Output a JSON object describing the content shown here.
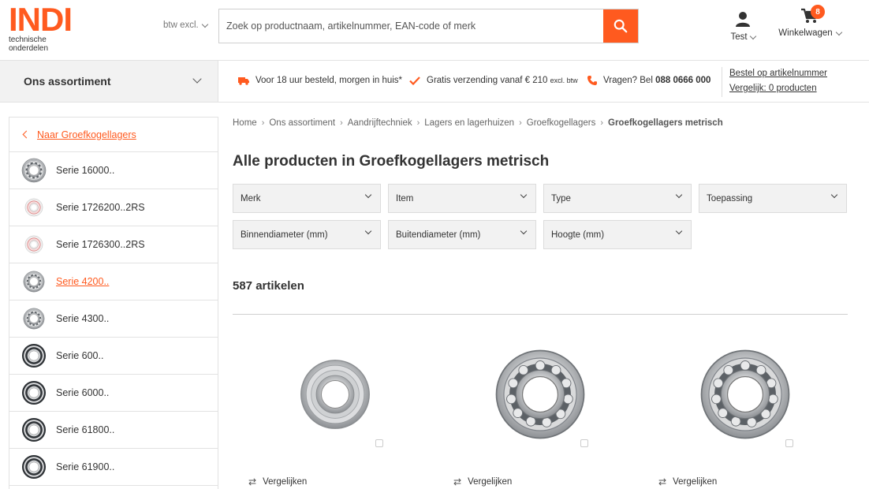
{
  "header": {
    "logo_text": "INDI",
    "logo_sub": "technische onderdelen",
    "vat_toggle": "btw excl.",
    "search_placeholder": "Zoek op productnaam, artikelnummer, EAN-code of merk",
    "account_label": "Test",
    "cart_label": "Winkelwagen",
    "cart_count": "8"
  },
  "usp": {
    "assortment_label": "Ons assortiment",
    "delivery": "Voor 18 uur besteld, morgen in huis*",
    "shipping_main": "Gratis verzending vanaf € 210",
    "shipping_small": "excl. btw",
    "phone_prefix": "Vragen? Bel",
    "phone_number": "088 0666 000",
    "order_by_number": "Bestel op artikelnummer",
    "compare_link": "Vergelijk: 0 producten"
  },
  "sidebar": {
    "back_label": "Naar Groefkogellagers",
    "items": [
      {
        "label": "Serie 16000..",
        "icon": "bearing-icon"
      },
      {
        "label": "Serie 1726200..2RS",
        "icon": "bearing-icon"
      },
      {
        "label": "Serie 1726300..2RS",
        "icon": "bearing-icon"
      },
      {
        "label": "Serie 4200..",
        "icon": "bearing-icon"
      },
      {
        "label": "Serie 4300..",
        "icon": "bearing-icon"
      },
      {
        "label": "Serie 600..",
        "icon": "bearing-icon"
      },
      {
        "label": "Serie 6000..",
        "icon": "bearing-icon"
      },
      {
        "label": "Serie 61800..",
        "icon": "bearing-icon"
      },
      {
        "label": "Serie 61900..",
        "icon": "bearing-icon"
      }
    ]
  },
  "breadcrumb": [
    "Home",
    "Ons assortiment",
    "Aandrijftechniek",
    "Lagers en lagerhuizen",
    "Groefkogellagers",
    "Groefkogellagers metrisch"
  ],
  "page_title": "Alle producten in Groefkogellagers metrisch",
  "filters": [
    "Merk",
    "Item",
    "Type",
    "Toepassing",
    "Binnendiameter (mm)",
    "Buitendiameter (mm)",
    "Hoogte (mm)"
  ],
  "result_count": "587 artikelen",
  "products": [
    {
      "compare_label": "Vergelijken"
    },
    {
      "compare_label": "Vergelijken"
    },
    {
      "compare_label": "Vergelijken"
    }
  ],
  "colors": {
    "accent": "#ff5a1f",
    "panel": "#f2f2f2",
    "border": "#e2e2e2"
  }
}
